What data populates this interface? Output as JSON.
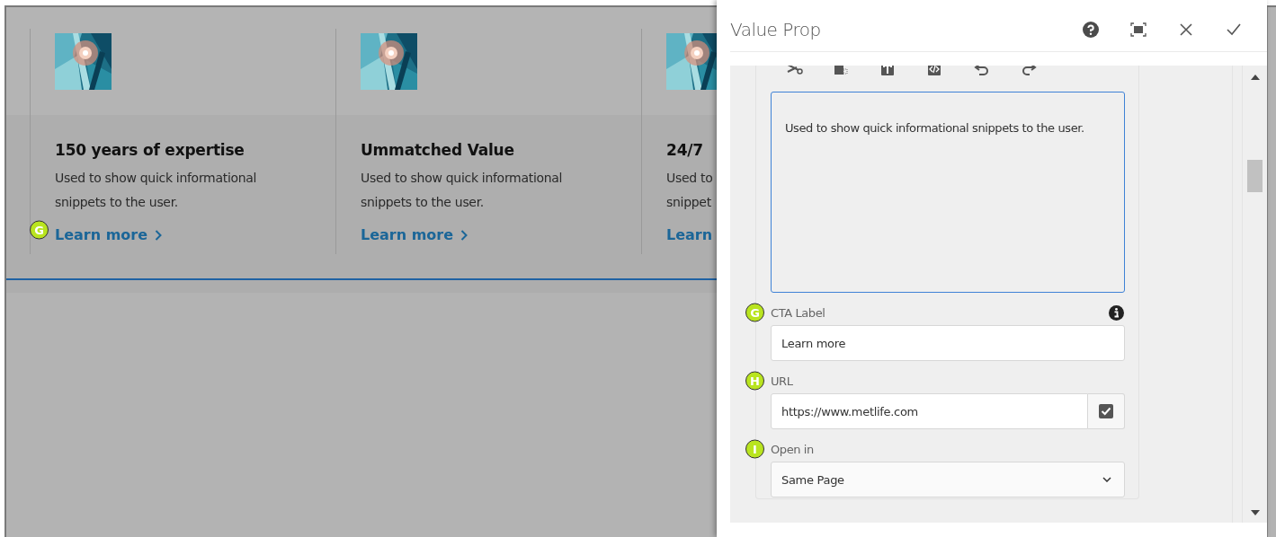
{
  "page": {
    "cards": [
      {
        "title": "150 years of expertise",
        "description_lines": [
          "Used to show quick informational",
          "snippets to the user."
        ],
        "link": "Learn more",
        "chevron": true,
        "marker": "G"
      },
      {
        "title": "Ummatched Value",
        "description_lines": [
          "Used to show quick informational",
          "snippets to the user."
        ],
        "link": "Learn more",
        "chevron": true
      },
      {
        "title": "24/7",
        "description_lines": [
          "Used to",
          "snippet"
        ],
        "link": "Learn",
        "chevron": false
      }
    ]
  },
  "dialog": {
    "title": "Value Prop",
    "rte_text": "Used to show quick informational snippets to the user.",
    "fields": [
      {
        "kind": "text",
        "label": "CTA Label",
        "value": "Learn more",
        "marker": "G",
        "info": true
      },
      {
        "kind": "url",
        "label": "URL",
        "value": "https://www.metlife.com",
        "marker": "H",
        "info": false
      },
      {
        "kind": "select",
        "label": "Open in",
        "value": "Same Page",
        "marker": "I",
        "info": false
      }
    ]
  }
}
